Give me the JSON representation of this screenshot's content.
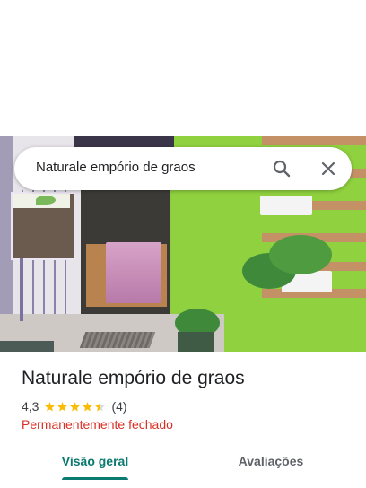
{
  "search": {
    "query": "Naturale empório de graos"
  },
  "place": {
    "name": "Naturale empório de graos",
    "rating": "4,3",
    "rating_value": 4.3,
    "review_count": "(4)",
    "status": "Permanentemente fechado"
  },
  "tabs": [
    {
      "label": "Visão geral",
      "selected": true
    },
    {
      "label": "Avaliações",
      "selected": false
    }
  ],
  "colors": {
    "accent": "#0b7a70",
    "star": "#fbbc04",
    "status_closed": "#d93025"
  },
  "icons": {
    "search": "search-icon",
    "close": "close-icon",
    "star": "star-icon"
  }
}
